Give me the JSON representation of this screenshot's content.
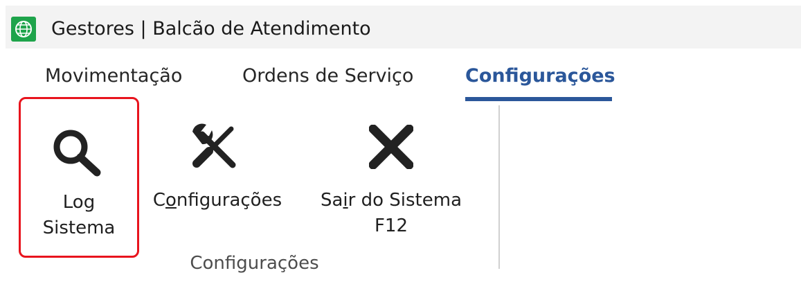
{
  "window": {
    "app_name": "Gestores",
    "separator": "|",
    "title": "Balcão de Atendimento",
    "icon": "globe-grid-icon",
    "icon_color": "#1ea44b"
  },
  "tabs": [
    {
      "label": "Movimentação",
      "active": false
    },
    {
      "label": "Ordens de Serviço",
      "active": false
    },
    {
      "label": "Configurações",
      "active": true
    }
  ],
  "accent_color": "#2b579a",
  "ribbon": {
    "buttons": [
      {
        "icon": "magnifier-icon",
        "label_line1": "Log",
        "label_line2": "Sistema",
        "highlighted": true,
        "highlight_color": "#e8141d"
      },
      {
        "icon": "wrench-screwdriver-icon",
        "label_pre": "C",
        "label_accel": "o",
        "label_post": "nfigurações"
      },
      {
        "icon": "close-x-icon",
        "label_pre": "Sa",
        "label_accel": "i",
        "label_post": "r do Sistema",
        "label_line2": "F12"
      }
    ],
    "group_label": "Configurações"
  }
}
